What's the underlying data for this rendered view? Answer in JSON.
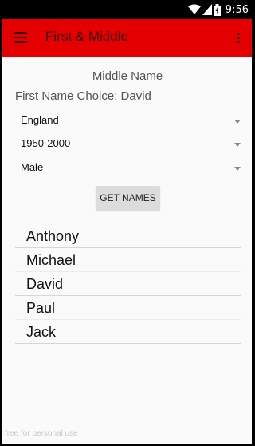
{
  "status_bar": {
    "time": "9:56",
    "icons": [
      "wifi-icon",
      "signal-icon",
      "battery-icon"
    ]
  },
  "app_bar": {
    "title": "First & Middle",
    "background": "#e40000",
    "menu_icon": "hamburger-menu-icon",
    "overflow_icon": "overflow-menu-icon"
  },
  "main": {
    "heading": "Middle Name",
    "choice_text": "First Name Choice: David",
    "spinners": [
      {
        "value": "England"
      },
      {
        "value": "1950-2000"
      },
      {
        "value": "Male"
      }
    ],
    "button_label": "GET NAMES",
    "names": [
      "Anthony",
      "Michael",
      "David",
      "Paul",
      "Jack"
    ]
  },
  "watermark": "free for personal use"
}
